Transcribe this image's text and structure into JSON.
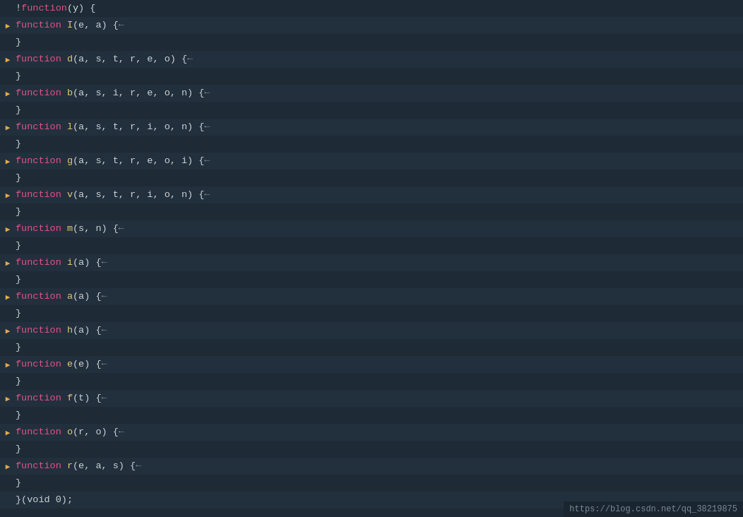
{
  "editor": {
    "background": "#1e2a35",
    "lines": [
      {
        "id": 0,
        "arrow": "none",
        "indent": 0,
        "text": "!function(y) {",
        "type": "top"
      },
      {
        "id": 1,
        "arrow": "right",
        "indent": 1,
        "keyword": "function",
        "fname": " I",
        "params": "(e, a) {",
        "collapse": "←"
      },
      {
        "id": 2,
        "arrow": "none",
        "indent": 1,
        "text": "}"
      },
      {
        "id": 3,
        "arrow": "right",
        "indent": 1,
        "keyword": "function",
        "fname": " d",
        "params": "(a, s, t, r, e, o) {",
        "collapse": "←"
      },
      {
        "id": 4,
        "arrow": "none",
        "indent": 1,
        "text": "}"
      },
      {
        "id": 5,
        "arrow": "right",
        "indent": 1,
        "keyword": "function",
        "fname": " b",
        "params": "(a, s, i, r, e, o, n) {",
        "collapse": "←"
      },
      {
        "id": 6,
        "arrow": "none",
        "indent": 1,
        "text": "}"
      },
      {
        "id": 7,
        "arrow": "right",
        "indent": 1,
        "keyword": "function",
        "fname": " l",
        "params": "(a, s, t, r, i, o, n) {",
        "collapse": "←"
      },
      {
        "id": 8,
        "arrow": "none",
        "indent": 1,
        "text": "}"
      },
      {
        "id": 9,
        "arrow": "right",
        "indent": 1,
        "keyword": "function",
        "fname": " g",
        "params": "(a, s, t, r, e, o, i) {",
        "collapse": "←"
      },
      {
        "id": 10,
        "arrow": "none",
        "indent": 1,
        "text": "}"
      },
      {
        "id": 11,
        "arrow": "right",
        "indent": 1,
        "keyword": "function",
        "fname": " v",
        "params": "(a, s, t, r, i, o, n) {",
        "collapse": "←"
      },
      {
        "id": 12,
        "arrow": "none",
        "indent": 1,
        "text": "}"
      },
      {
        "id": 13,
        "arrow": "right",
        "indent": 1,
        "keyword": "function",
        "fname": " m",
        "params": "(s, n) {",
        "collapse": "←"
      },
      {
        "id": 14,
        "arrow": "none",
        "indent": 1,
        "text": "}"
      },
      {
        "id": 15,
        "arrow": "right",
        "indent": 1,
        "keyword": "function",
        "fname": " i",
        "params": "(a) {",
        "collapse": "←"
      },
      {
        "id": 16,
        "arrow": "none",
        "indent": 1,
        "text": "}"
      },
      {
        "id": 17,
        "arrow": "right",
        "indent": 1,
        "keyword": "function",
        "fname": " a",
        "params": "(a) {",
        "collapse": "←"
      },
      {
        "id": 18,
        "arrow": "none",
        "indent": 1,
        "text": "}"
      },
      {
        "id": 19,
        "arrow": "right",
        "indent": 1,
        "keyword": "function",
        "fname": " h",
        "params": "(a) {",
        "collapse": "←"
      },
      {
        "id": 20,
        "arrow": "none",
        "indent": 1,
        "text": "}"
      },
      {
        "id": 21,
        "arrow": "right",
        "indent": 1,
        "keyword": "function",
        "fname": " e",
        "params": "(e) {",
        "collapse": "←"
      },
      {
        "id": 22,
        "arrow": "none",
        "indent": 1,
        "text": "}"
      },
      {
        "id": 23,
        "arrow": "right",
        "indent": 1,
        "keyword": "function",
        "fname": " f",
        "params": "(t) {",
        "collapse": "←"
      },
      {
        "id": 24,
        "arrow": "none",
        "indent": 1,
        "text": "}"
      },
      {
        "id": 25,
        "arrow": "right",
        "indent": 1,
        "keyword": "function",
        "fname": " o",
        "params": "(r, o) {",
        "collapse": "←"
      },
      {
        "id": 26,
        "arrow": "none",
        "indent": 1,
        "text": "}"
      },
      {
        "id": 27,
        "arrow": "right",
        "indent": 1,
        "keyword": "function",
        "fname": " r",
        "params": "(e, a, s) {",
        "collapse": "←"
      },
      {
        "id": 28,
        "arrow": "none",
        "indent": 1,
        "text": "}"
      },
      {
        "id": 29,
        "arrow": "none",
        "indent": 0,
        "text": "}(void 0);",
        "type": "bottom"
      }
    ],
    "watermark": "https://blog.csdn.net/qq_38219875"
  }
}
